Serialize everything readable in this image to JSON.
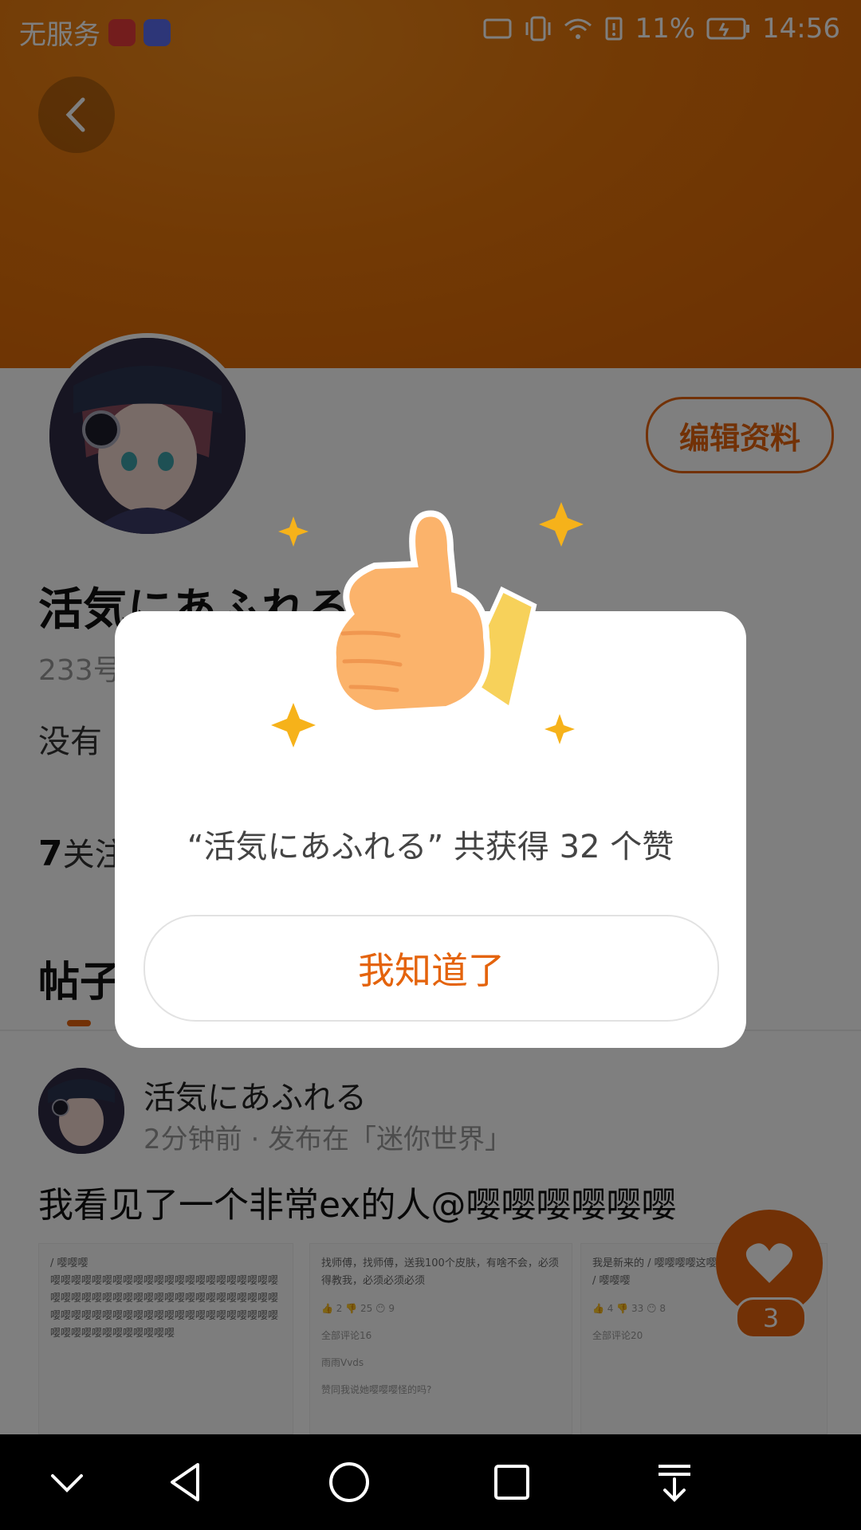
{
  "status_bar": {
    "carrier": "无服务",
    "battery": "11%",
    "time": "14:56"
  },
  "profile": {
    "name": "活気にあふれる",
    "id_prefix": "233号",
    "bio_prefix": "没有",
    "follow_count": "7",
    "follow_label": "关注",
    "edit_button": "编辑资料"
  },
  "tabs": {
    "posts_label": "帖子"
  },
  "post": {
    "author": "活気にあふれる",
    "meta": "2分钟前 · 发布在「迷你世界」",
    "text": "我看见了一个非常ex的人@嘤嘤嘤嘤嘤嘤",
    "thumb1": {
      "title": "/ 嘤嘤嘤",
      "body": "嘤嘤嘤嘤嘤嘤嘤嘤嘤嘤嘤嘤嘤嘤嘤嘤嘤嘤嘤嘤嘤嘤嘤嘤嘤嘤嘤嘤嘤嘤嘤嘤嘤嘤嘤嘤嘤嘤嘤嘤嘤嘤嘤嘤嘤嘤嘤嘤嘤嘤嘤嘤嘤嘤嘤嘤嘤嘤嘤嘤嘤嘤嘤嘤嘤嘤嘤嘤嘤嘤嘤嘤嘤嘤嘤嘤嘤嘤"
    },
    "thumb2": {
      "body": "找师傅，找师傅，送我100个皮肤，有啥不会，必须得教我，必须必须必须",
      "stats": "👍 2   👎 25   😶 9",
      "comments": "全部评论16",
      "commenter": "雨雨Vvds",
      "comment": "赞同我说她嘤嘤嘤怪的吗?"
    },
    "thumb3": {
      "body": "我是新来的 / 嘤嘤嘤嘤这嘤嘤嘤，谁要是欺负我 / 嘤嘤嘤",
      "stats": "👍 4   👎 33   😶 8",
      "comments": "全部评论20"
    }
  },
  "fab": {
    "count": "3"
  },
  "dialog": {
    "message": "“活気にあふれる” 共获得 32 个赞",
    "confirm_button": "我知道了"
  },
  "colors": {
    "accent": "#e4630c",
    "header": "#e5740a"
  }
}
